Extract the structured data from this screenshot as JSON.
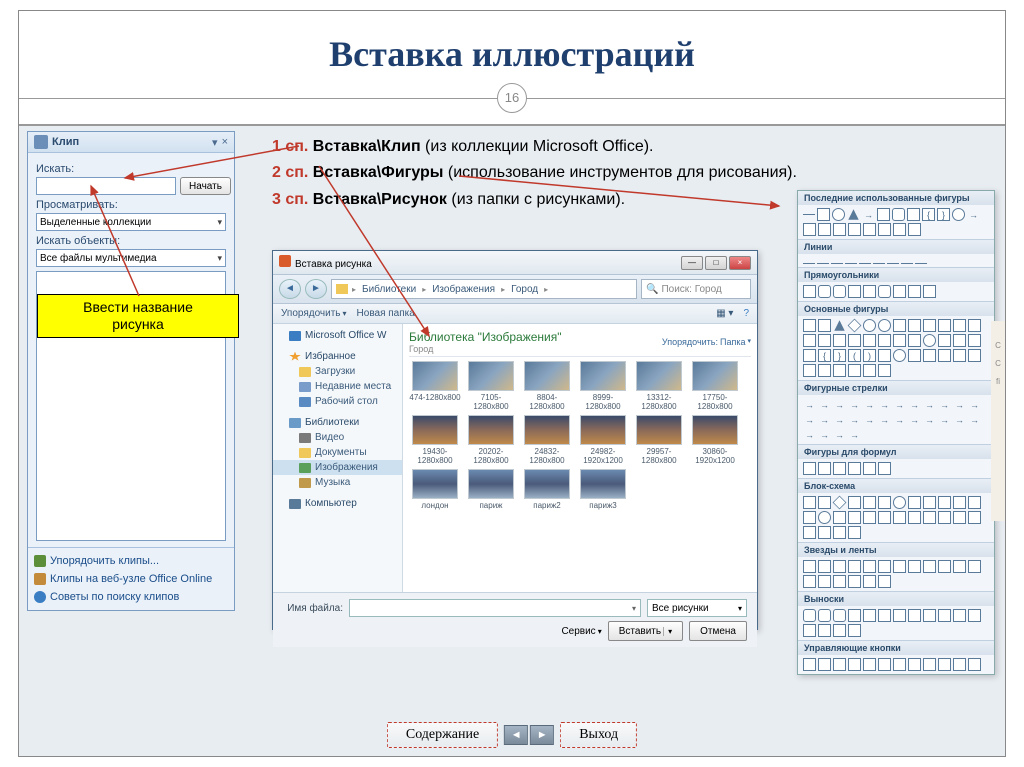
{
  "title": "Вставка иллюстраций",
  "page_number": "16",
  "main_text": {
    "line1_prefix": "1 сп.",
    "line1_bold": " Вставка\\Клип",
    "line1_rest": " (из коллекции Microsoft Office).",
    "line2_prefix": "2 сп.",
    "line2_bold": " Вставка\\Фигуры",
    "line2_rest": " (использование инструментов для рисования).",
    "line3_prefix": "3 сп.",
    "line3_bold": " Вставка\\Рисунок",
    "line3_rest": " (из папки с рисунками)."
  },
  "annotation": {
    "line1": "Ввести название",
    "line2": "рисунка"
  },
  "clip_panel": {
    "title": "Клип",
    "search_label": "Искать:",
    "search_btn": "Начать",
    "scope_label": "Просматривать:",
    "scope_value": "Выделенные коллекции",
    "type_label": "Искать объекты:",
    "type_value": "Все файлы мультимедиа",
    "link1": "Упорядочить клипы...",
    "link2": "Клипы на веб-узле Office Online",
    "link3": "Советы по поиску клипов"
  },
  "file_dialog": {
    "title": "Вставка рисунка",
    "path": [
      "Библиотеки",
      "Изображения",
      "Город"
    ],
    "search_placeholder": "Поиск: Город",
    "toolbar_organize": "Упорядочить",
    "toolbar_new": "Новая папка",
    "side_top": "Microsoft Office W",
    "favorites": "Избранное",
    "fav_items": [
      "Загрузки",
      "Недавние места",
      "Рабочий стол"
    ],
    "libraries": "Библиотеки",
    "lib_items": [
      "Видео",
      "Документы",
      "Изображения",
      "Музыка"
    ],
    "computer": "Компьютер",
    "lib_title": "Библиотека \"Изображения\"",
    "lib_sub": "Город",
    "lib_org": "Упорядочить:",
    "lib_org_val": "Папка",
    "thumbs_row1": [
      "474-1280x800",
      "7105-1280x800",
      "8804-1280x800",
      "8999-1280x800",
      "13312-1280x800",
      "17750-1280x800"
    ],
    "thumbs_row2": [
      "19430-1280x800",
      "20202-1280x800",
      "24832-1280x800",
      "24982-1920x1200",
      "29957-1280x800",
      "30860-1920x1200"
    ],
    "thumbs_row3": [
      "лондон",
      "париж",
      "париж2",
      "париж3"
    ],
    "file_label": "Имя файла:",
    "file_type": "Все рисунки",
    "tools": "Сервис",
    "insert": "Вставить",
    "cancel": "Отмена"
  },
  "shapes": {
    "sec1": "Последние использованные фигуры",
    "sec2": "Линии",
    "sec3": "Прямоугольники",
    "sec4": "Основные фигуры",
    "sec5": "Фигурные стрелки",
    "sec6": "Фигуры для формул",
    "sec7": "Блок-схема",
    "sec8": "Звезды и ленты",
    "sec9": "Выноски",
    "sec10": "Управляющие кнопки"
  },
  "nav": {
    "contents": "Содержание",
    "exit": "Выход"
  }
}
